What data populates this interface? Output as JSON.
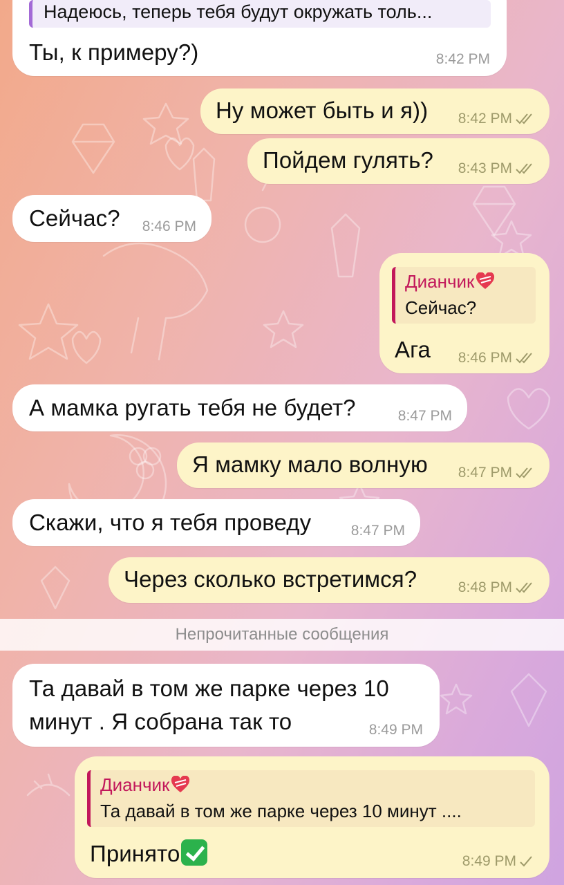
{
  "chat": {
    "unread_divider": "Непрочитанные сообщения",
    "messages": [
      {
        "dir": "in",
        "quote_text": "Надеюсь, теперь тебя будут окружать толь...",
        "text": "Ты, к примеру?)",
        "time": "8:42 PM"
      },
      {
        "dir": "out",
        "text": "Ну может быть и я))",
        "time": "8:42 PM",
        "status": "read"
      },
      {
        "dir": "out",
        "text": "Пойдем гулять?",
        "time": "8:43 PM",
        "status": "read"
      },
      {
        "dir": "in",
        "text": "Сейчас?",
        "time": "8:46 PM"
      },
      {
        "dir": "out",
        "reply_name": "Дианчик",
        "reply_text": "Сейчас?",
        "text": "Ага",
        "time": "8:46 PM",
        "status": "read"
      },
      {
        "dir": "in",
        "text": "А мамка ругать тебя не будет?",
        "time": "8:47 PM"
      },
      {
        "dir": "out",
        "text": "Я мамку мало волную",
        "time": "8:47 PM",
        "status": "read"
      },
      {
        "dir": "in",
        "text": "Скажи, что я тебя проведу",
        "time": "8:47 PM"
      },
      {
        "dir": "out",
        "text": "Через сколько встретимся?",
        "time": "8:48 PM",
        "status": "read"
      },
      {
        "dir": "in",
        "text_line1": "Та давай в том же парке через 10",
        "text_line2": "минут . Я собрана так то",
        "time": "8:49 PM"
      },
      {
        "dir": "out",
        "reply_name": "Дианчик",
        "reply_text": "Та давай в том же парке через 10 минут ....",
        "text": "Принято",
        "emoji": "check-mark-button",
        "time": "8:49 PM",
        "status": "sent"
      }
    ]
  },
  "colors": {
    "incoming_bubble": "#ffffff",
    "outgoing_bubble": "#fdf4c8",
    "reply_accent": "#c2185b",
    "time_outgoing": "#9e9a6a",
    "time_incoming": "#9a9a9a"
  }
}
